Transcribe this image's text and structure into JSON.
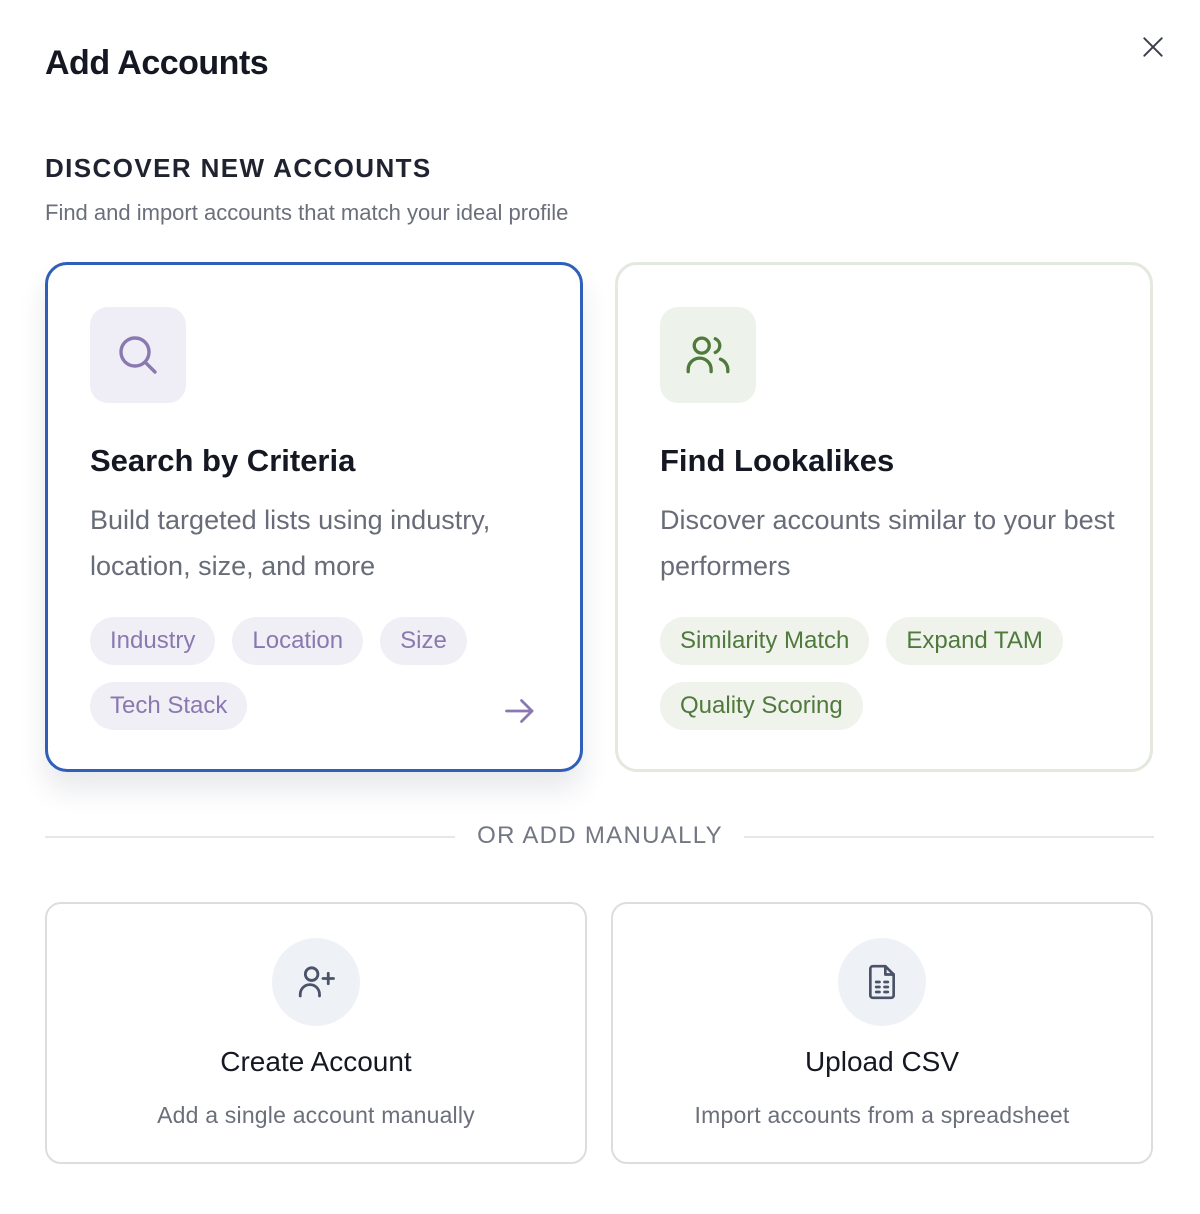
{
  "modal": {
    "title": "Add Accounts",
    "close_icon": "close-icon"
  },
  "discover": {
    "heading": "DISCOVER NEW ACCOUNTS",
    "subtitle": "Find and import accounts that match your ideal profile",
    "cards": [
      {
        "icon": "search-icon",
        "title": "Search by Criteria",
        "description": "Build targeted lists using industry, location, size, and more",
        "tags": [
          "Industry",
          "Location",
          "Size",
          "Tech Stack"
        ],
        "arrow_icon": "arrow-right-icon",
        "selected": true
      },
      {
        "icon": "users-icon",
        "title": "Find Lookalikes",
        "description": "Discover accounts similar to your best performers",
        "tags": [
          "Similarity Match",
          "Expand TAM",
          "Quality Scoring"
        ],
        "selected": false
      }
    ]
  },
  "divider": {
    "label": "OR ADD MANUALLY"
  },
  "manual": [
    {
      "icon": "user-plus-icon",
      "title": "Create Account",
      "description": "Add a single account manually"
    },
    {
      "icon": "file-spreadsheet-icon",
      "title": "Upload CSV",
      "description": "Import accounts from a spreadsheet"
    }
  ],
  "colors": {
    "selected_border": "#2f5fb8",
    "search_accent": "#8a79b0",
    "lookalike_accent": "#4f7a3c",
    "muted_text": "#6b6f7b"
  }
}
